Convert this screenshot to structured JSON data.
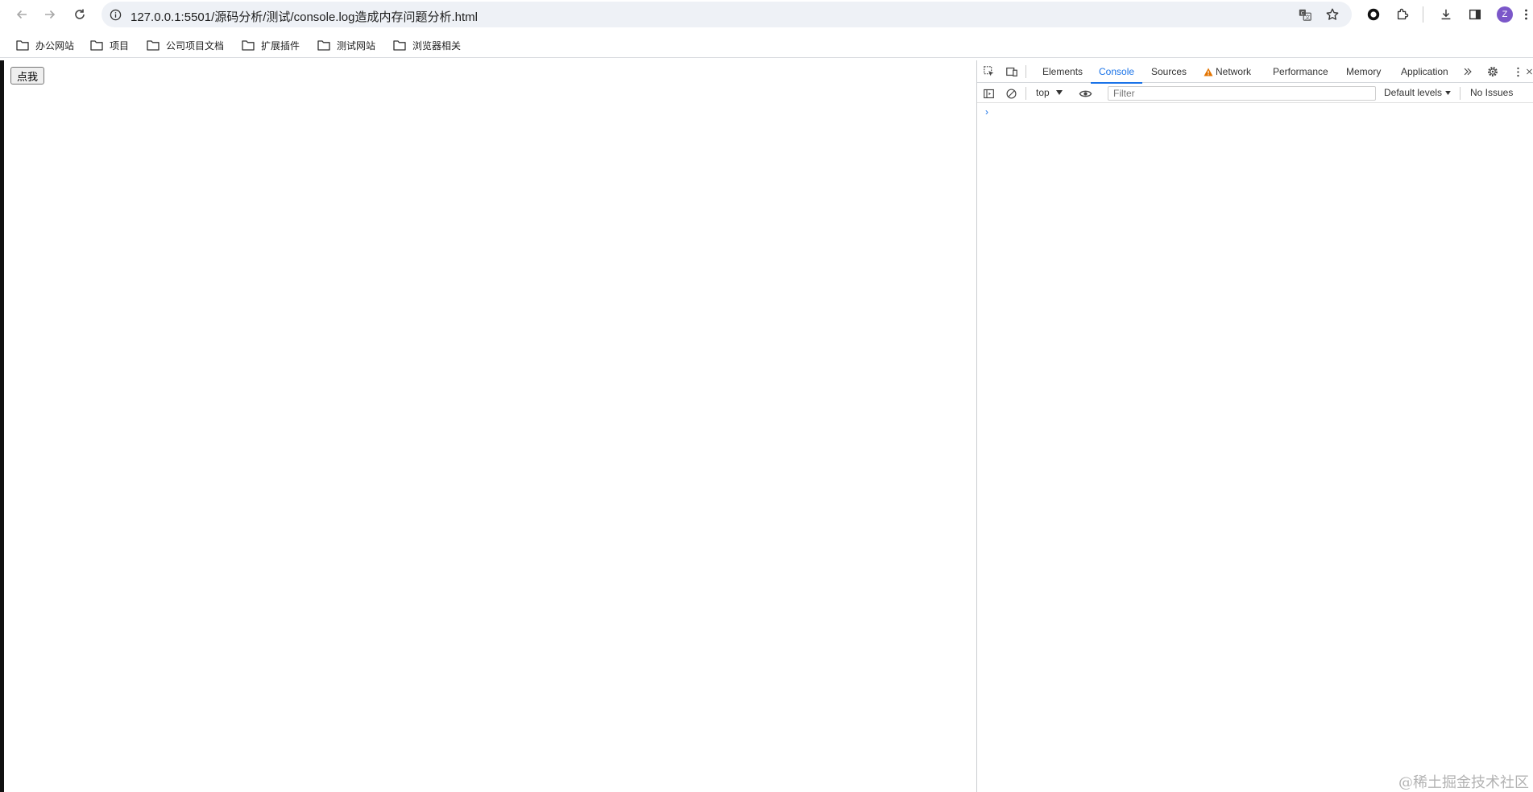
{
  "address_bar": {
    "url": "127.0.0.1:5501/源码分析/测试/console.log造成内存问题分析.html"
  },
  "profile": {
    "initial": "Z",
    "color": "#7b57c9"
  },
  "bookmarks": [
    {
      "label": "办公网站",
      "icon": "folder-icon"
    },
    {
      "label": "项目",
      "icon": "folder-icon"
    },
    {
      "label": "公司项目文档",
      "icon": "folder-icon"
    },
    {
      "label": "扩展插件",
      "icon": "folder-icon"
    },
    {
      "label": "测试网站",
      "icon": "folder-icon"
    },
    {
      "label": "浏览器相关",
      "icon": "folder-icon"
    }
  ],
  "page": {
    "button_label": "点我"
  },
  "devtools": {
    "tabs": [
      {
        "label": "Elements",
        "active": false
      },
      {
        "label": "Console",
        "active": true
      },
      {
        "label": "Sources",
        "active": false
      },
      {
        "label": "Network",
        "active": false,
        "warning": true
      },
      {
        "label": "Performance",
        "active": false
      },
      {
        "label": "Memory",
        "active": false
      },
      {
        "label": "Application",
        "active": false
      }
    ],
    "console": {
      "context": "top",
      "filter_placeholder": "Filter",
      "levels_label": "Default levels",
      "issues_label": "No Issues",
      "prompt": "›"
    },
    "accent_color": "#1a73e8",
    "warning_color": "#e37400"
  },
  "watermark": "@稀土掘金技术社区"
}
